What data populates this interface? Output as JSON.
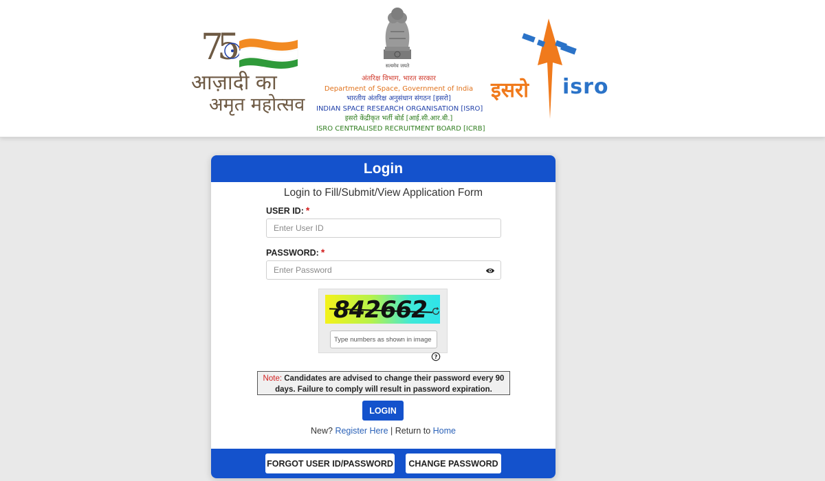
{
  "header": {
    "akam_logo": {
      "number": "75",
      "line1": "आज़ादी का",
      "line2": "अमृत महोत्सव"
    },
    "emblem_caption": "सत्यमेव जयते",
    "department": [
      {
        "text": "अंतरिक्ष विभाग, भारत सरकार",
        "color": "#d0392b"
      },
      {
        "text": "Department of Space, Government of India",
        "color": "#e0711a"
      },
      {
        "text": "भारतीय अंतरिक्ष अनुसंधान संगठन [इसरो]",
        "color": "#1f3fa8"
      },
      {
        "text": "INDIAN SPACE RESEARCH ORGANISATION [ISRO]",
        "color": "#1f3fa8"
      },
      {
        "text": "इसरो केंद्रीकृत भर्ती बोर्ड [आई.सी.आर.बी.]",
        "color": "#2f7d1f"
      },
      {
        "text": "ISRO CENTRALISED RECRUITMENT BOARD [ICRB]",
        "color": "#2f7d1f"
      }
    ],
    "isro_logo": {
      "hindi": "इसरो",
      "english": "isro"
    }
  },
  "login": {
    "title": "Login",
    "subtitle": "Login to Fill/Submit/View Application Form",
    "user_id_label": "USER ID:",
    "user_id_placeholder": "Enter User ID",
    "password_label": "PASSWORD:",
    "password_placeholder": "Enter Password",
    "required_mark": "*",
    "captcha_text": "842662",
    "captcha_placeholder": "Type numbers as shown in image",
    "note_prefix": "Note:",
    "note_text": " Candidates are advised to change their password every 90 days. Failure to comply will result in password expiration.",
    "login_button": "LOGIN",
    "new_text": "New?",
    "register_link": "Register Here",
    "return_text": " | Return to ",
    "home_link": "Home",
    "forgot_button": "FORGOT USER ID/PASSWORD",
    "change_password_button": "CHANGE PASSWORD"
  },
  "colors": {
    "primary": "#1452cc",
    "required": "#d21f1f",
    "link": "#2b62b8"
  },
  "icons": [
    "emblem-icon",
    "eye-icon",
    "refresh-icon",
    "help-icon",
    "akam-flag-icon",
    "isro-rocket-icon"
  ]
}
